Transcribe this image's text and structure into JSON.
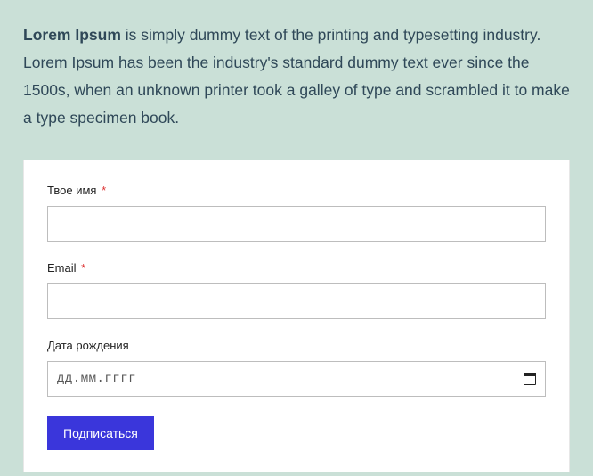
{
  "intro": {
    "bold": "Lorem Ipsum",
    "rest": " is simply dummy text of the printing and typesetting industry. Lorem Ipsum has been the industry's standard dummy text ever since the 1500s, when an unknown printer took a galley of type and scrambled it to make a type specimen book."
  },
  "form": {
    "name_label": "Твое имя",
    "email_label": "Email",
    "dob_label": "Дата рождения",
    "required_mark": "*",
    "date_placeholder": "дд.мм.гггг",
    "submit_label": "Подписаться"
  }
}
